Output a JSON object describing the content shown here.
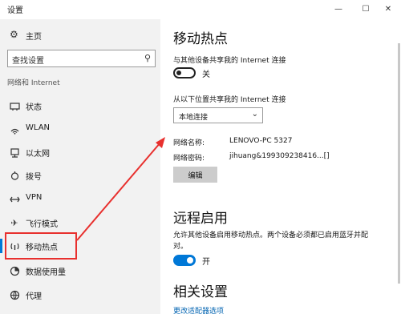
{
  "window": {
    "title": "设置",
    "controls": [
      "—",
      "☐",
      "✕"
    ]
  },
  "sidebar": {
    "home_label": "主页",
    "search_placeholder": "查找设置",
    "section_title": "网络和 Internet",
    "items": [
      {
        "label": "状态",
        "icon": "status-icon"
      },
      {
        "label": "WLAN",
        "icon": "wifi-icon"
      },
      {
        "label": "以太网",
        "icon": "ethernet-icon"
      },
      {
        "label": "拨号",
        "icon": "dialup-icon"
      },
      {
        "label": "VPN",
        "icon": "vpn-icon"
      },
      {
        "label": "飞行模式",
        "icon": "airplane-icon"
      },
      {
        "label": "移动热点",
        "icon": "hotspot-icon",
        "active": true
      },
      {
        "label": "数据使用量",
        "icon": "data-usage-icon"
      },
      {
        "label": "代理",
        "icon": "proxy-icon"
      }
    ]
  },
  "main": {
    "title": "移动热点",
    "share_label": "与其他设备共享我的 Internet 连接",
    "share_toggle_state": "关",
    "share_from_label": "从以下位置共享我的 Internet 连接",
    "share_from_value": "本地连接",
    "network_name_label": "网络名称:",
    "network_name_value": "LENOVO-PC 5327",
    "network_password_label": "网络密码:",
    "network_password_value": "jihuang&199309238416...[]",
    "edit_button": "编辑",
    "remote_title": "远程启用",
    "remote_desc_line1": "允许其他设备启用移动热点。两个设备必须都已启用蓝牙并配",
    "remote_desc_line2": "对。",
    "remote_toggle_state": "开",
    "related_title": "相关设置",
    "related_link": "更改适配器选项"
  },
  "colors": {
    "accent": "#0078d7",
    "annotation": "#e8302e",
    "sidebar_bg": "#f2f2f2"
  }
}
